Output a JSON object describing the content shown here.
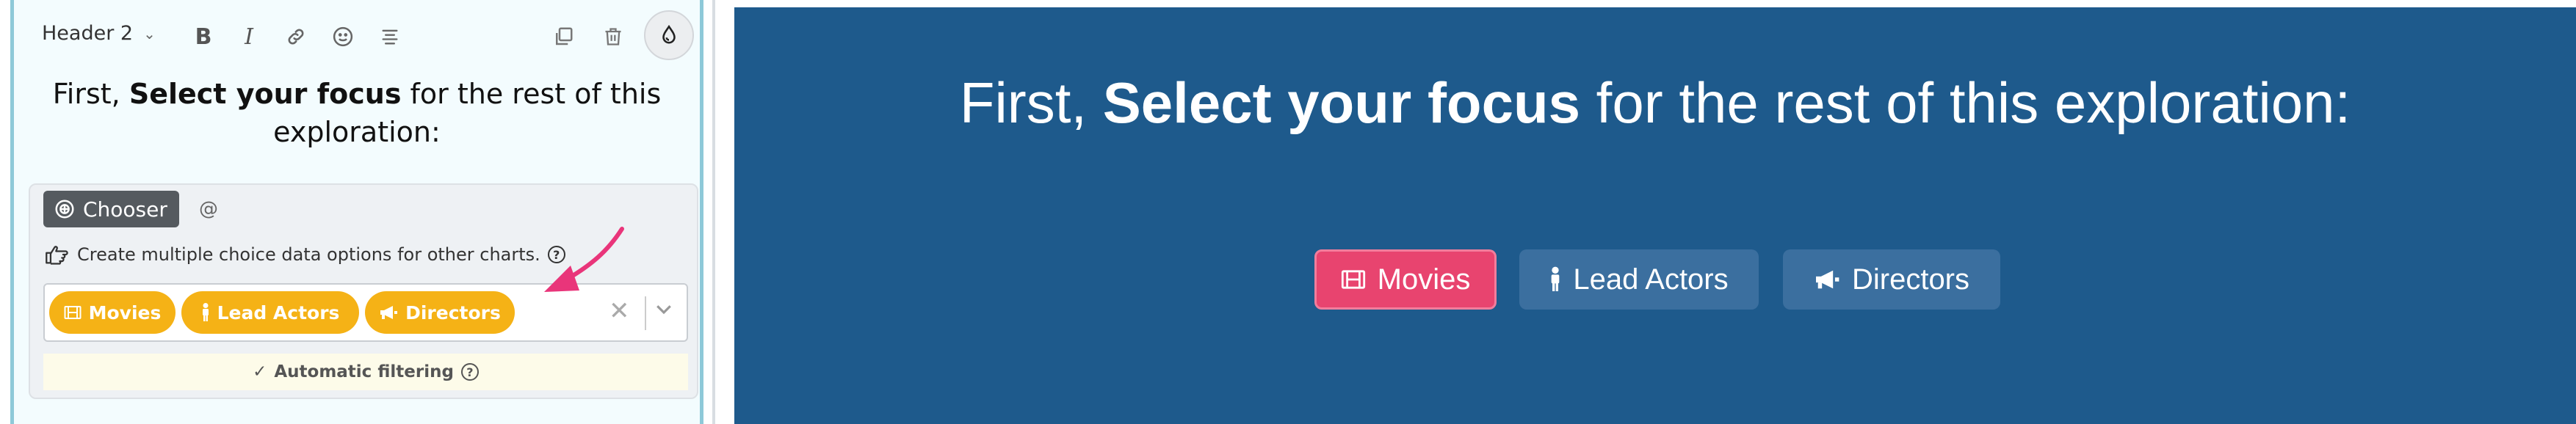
{
  "editor": {
    "toolbar": {
      "block_style": "Header 2",
      "bold_label": "B",
      "italic_label": "I"
    },
    "heading": {
      "prefix": "First, ",
      "bold": "Select your focus",
      "suffix": " for the rest of this exploration:"
    },
    "chooser": {
      "tag_label": "Chooser",
      "at_symbol": "@",
      "hint": "Create multiple choice data options for other charts.",
      "help_symbol": "?",
      "selected_options": [
        {
          "label": "Movies",
          "icon": "film-icon"
        },
        {
          "label": "Lead Actors",
          "icon": "person-icon"
        },
        {
          "label": "Directors",
          "icon": "megaphone-icon"
        }
      ],
      "clear_symbol": "✕",
      "auto_filter_label": "Automatic filtering",
      "pill_color": "#f5b216"
    }
  },
  "preview": {
    "heading": {
      "prefix": "First, ",
      "bold": "Select your focus",
      "suffix": " for the rest of this exploration:"
    },
    "buttons": [
      {
        "label": "Movies",
        "icon": "film-icon",
        "selected": true
      },
      {
        "label": "Lead Actors",
        "icon": "person-icon",
        "selected": false
      },
      {
        "label": "Directors",
        "icon": "megaphone-icon",
        "selected": false
      }
    ],
    "background_color": "#1e5a8c",
    "selected_color": "#e8446f"
  }
}
